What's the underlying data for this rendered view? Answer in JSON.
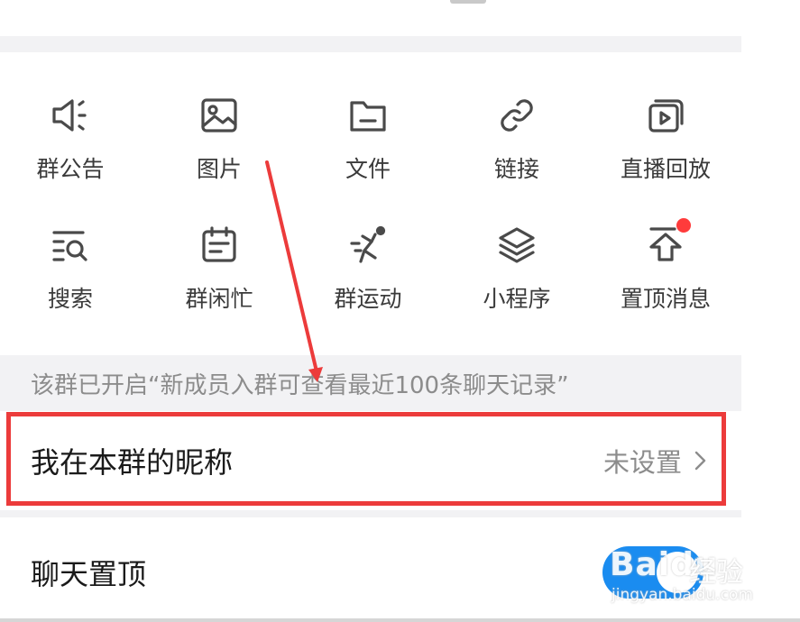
{
  "toolbar": {
    "items": [
      {
        "label": "群公告",
        "icon": "speaker-icon"
      },
      {
        "label": "图片",
        "icon": "image-icon"
      },
      {
        "label": "文件",
        "icon": "folder-icon"
      },
      {
        "label": "链接",
        "icon": "link-icon"
      },
      {
        "label": "直播回放",
        "icon": "playback-icon"
      },
      {
        "label": "搜索",
        "icon": "search-icon"
      },
      {
        "label": "群闲忙",
        "icon": "calendar-icon"
      },
      {
        "label": "群运动",
        "icon": "runner-icon"
      },
      {
        "label": "小程序",
        "icon": "layers-icon"
      },
      {
        "label": "置顶消息",
        "icon": "pin-top-icon"
      }
    ]
  },
  "notice": "该群已开启“新成员入群可查看最近100条聊天记录”",
  "settings": {
    "nickname": {
      "label": "我在本群的昵称",
      "value": "未设置"
    },
    "pin_chat": {
      "label": "聊天置顶",
      "enabled": true
    }
  },
  "watermark": {
    "logo": "Baidu",
    "text": "经验",
    "url": "jingyan.baidu.com"
  },
  "colors": {
    "accent": "#1a8cf0",
    "highlight": "#ec3b3b",
    "badge": "#ff3b3b",
    "icon": "#4a4a4a"
  }
}
